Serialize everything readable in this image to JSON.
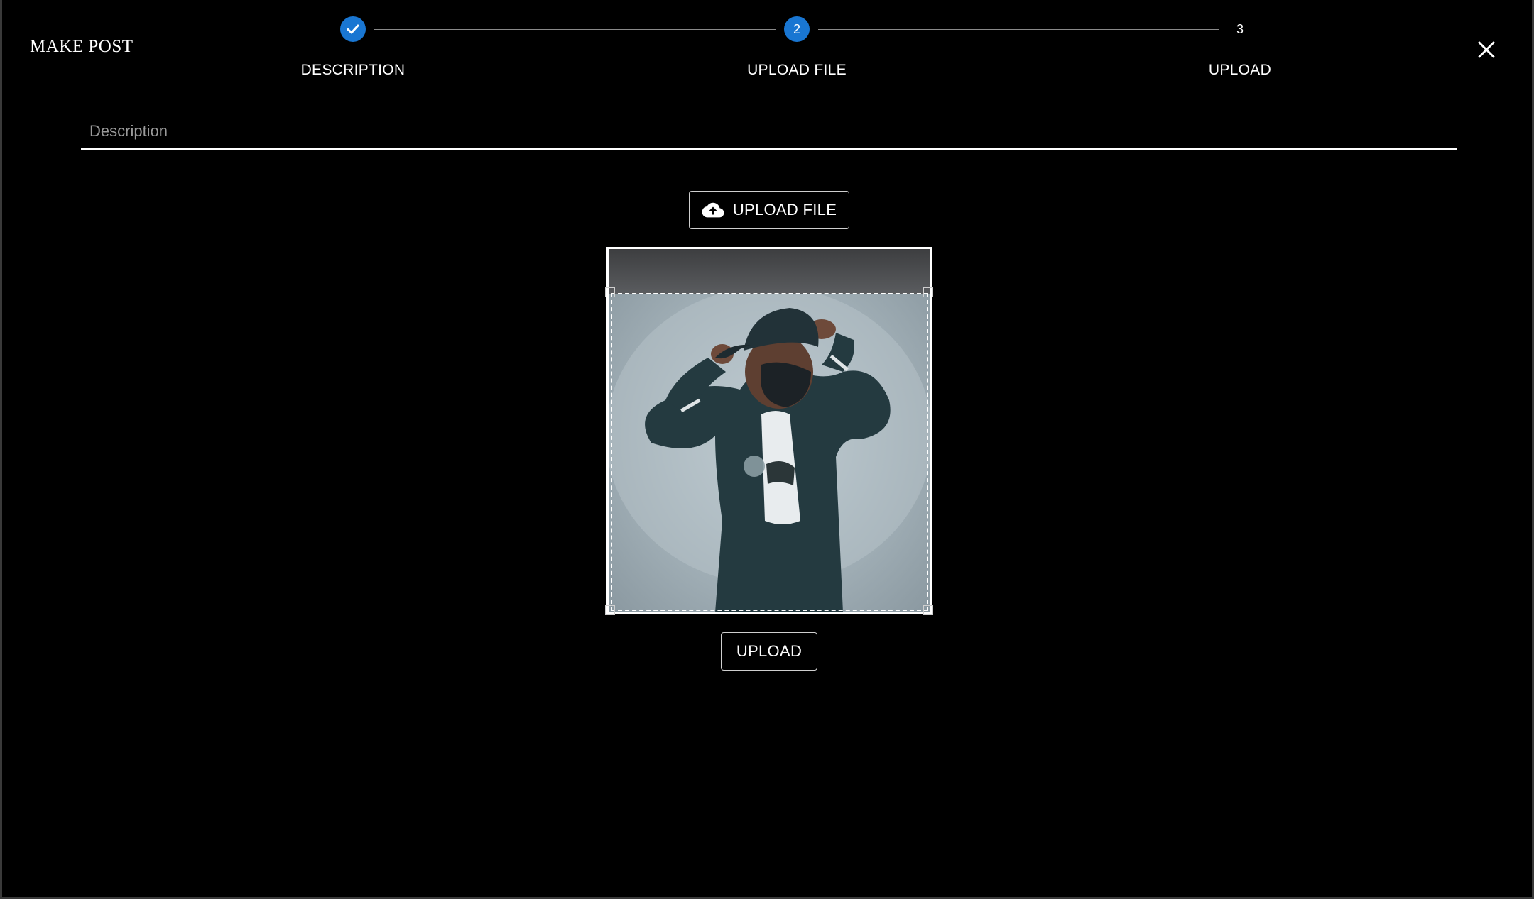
{
  "dialog": {
    "title": "MAKE POST",
    "close_icon": "close-icon"
  },
  "stepper": {
    "steps": [
      {
        "label": "DESCRIPTION",
        "state": "completed",
        "indicator": "check-icon"
      },
      {
        "label": "UPLOAD FILE",
        "state": "active",
        "number": "2"
      },
      {
        "label": "UPLOAD",
        "state": "pending",
        "number": "3"
      }
    ],
    "accent_color": "#1976d2"
  },
  "description": {
    "placeholder": "Description",
    "value": ""
  },
  "upload_file_button": {
    "label": "UPLOAD FILE",
    "icon": "cloud-upload-icon"
  },
  "image_cropper": {
    "image": "photo of person in cap, mask and varsity jacket against grey wall"
  },
  "upload_button": {
    "label": "UPLOAD"
  }
}
